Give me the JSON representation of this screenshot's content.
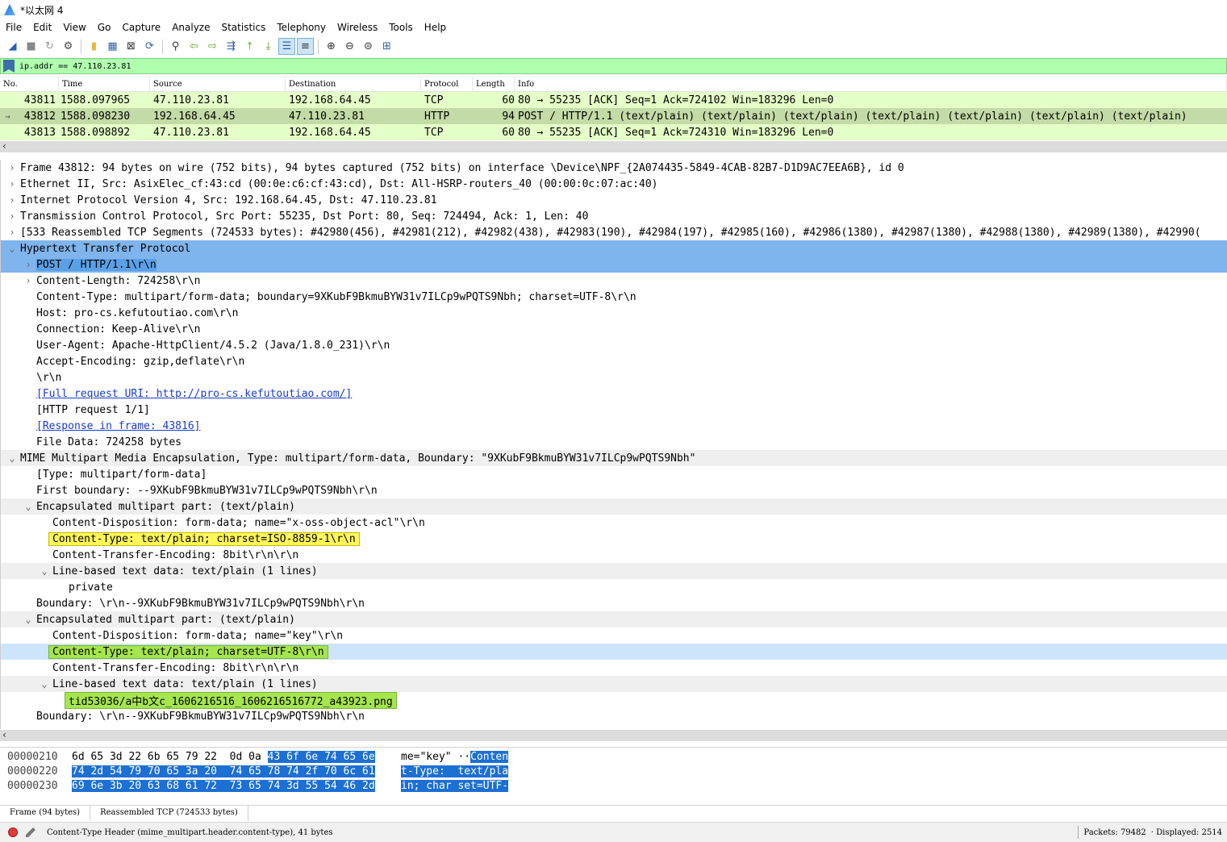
{
  "window": {
    "title": "*以太网 4"
  },
  "menu": [
    "File",
    "Edit",
    "View",
    "Go",
    "Capture",
    "Analyze",
    "Statistics",
    "Telephony",
    "Wireless",
    "Tools",
    "Help"
  ],
  "filter": {
    "value": "ip.addr == 47.110.23.81"
  },
  "packet_list": {
    "columns": [
      "No.",
      "Time",
      "Source",
      "Destination",
      "Protocol",
      "Length",
      "Info"
    ],
    "rows": [
      {
        "no": "43811",
        "time": "1588.097965",
        "src": "47.110.23.81",
        "dst": "192.168.64.45",
        "proto": "TCP",
        "len": "60",
        "info": "80 → 55235 [ACK] Seq=1 Ack=724102 Win=183296 Len=0"
      },
      {
        "no": "43812",
        "time": "1588.098230",
        "src": "192.168.64.45",
        "dst": "47.110.23.81",
        "proto": "HTTP",
        "len": "94",
        "info": "POST / HTTP/1.1  (text/plain) (text/plain) (text/plain) (text/plain) (text/plain) (text/plain) (text/plain)"
      },
      {
        "no": "43813",
        "time": "1588.098892",
        "src": "47.110.23.81",
        "dst": "192.168.64.45",
        "proto": "TCP",
        "len": "60",
        "info": "80 → 55235 [ACK] Seq=1 Ack=724310 Win=183296 Len=0"
      }
    ]
  },
  "tree": [
    {
      "level": 0,
      "arrow": "›",
      "text": "Frame 43812: 94 bytes on wire (752 bits), 94 bytes captured (752 bits) on interface \\Device\\NPF_{2A074435-5849-4CAB-82B7-D1D9AC7EEA6B}, id 0"
    },
    {
      "level": 0,
      "arrow": "›",
      "text": "Ethernet II, Src: AsixElec_cf:43:cd (00:0e:c6:cf:43:cd), Dst: All-HSRP-routers_40 (00:00:0c:07:ac:40)"
    },
    {
      "level": 0,
      "arrow": "›",
      "text": "Internet Protocol Version 4, Src: 192.168.64.45, Dst: 47.110.23.81"
    },
    {
      "level": 0,
      "arrow": "›",
      "text": "Transmission Control Protocol, Src Port: 55235, Dst Port: 80, Seq: 724494, Ack: 1, Len: 40"
    },
    {
      "level": 0,
      "arrow": "›",
      "text": "[533 Reassembled TCP Segments (724533 bytes): #42980(456), #42981(212), #42982(438), #42983(190), #42984(197), #42985(160), #42986(1380), #42987(1380), #42988(1380), #42989(1380), #42990("
    },
    {
      "level": 0,
      "arrow": "⌄",
      "text": "Hypertext Transfer Protocol"
    },
    {
      "level": 1,
      "arrow": "›",
      "text": "POST / HTTP/1.1\\r\\n"
    },
    {
      "level": 1,
      "arrow": "›",
      "text": "Content-Length: 724258\\r\\n"
    },
    {
      "level": 1,
      "arrow": "",
      "text": "Content-Type: multipart/form-data; boundary=9XKubF9BkmuBYW31v7ILCp9wPQTS9Nbh; charset=UTF-8\\r\\n"
    },
    {
      "level": 1,
      "arrow": "",
      "text": "Host: pro-cs.kefutoutiao.com\\r\\n"
    },
    {
      "level": 1,
      "arrow": "",
      "text": "Connection: Keep-Alive\\r\\n"
    },
    {
      "level": 1,
      "arrow": "",
      "text": "User-Agent: Apache-HttpClient/4.5.2 (Java/1.8.0_231)\\r\\n"
    },
    {
      "level": 1,
      "arrow": "",
      "text": "Accept-Encoding: gzip,deflate\\r\\n"
    },
    {
      "level": 1,
      "arrow": "",
      "text": "\\r\\n"
    },
    {
      "level": 1,
      "arrow": "",
      "text": "[Full request URI: http://pro-cs.kefutoutiao.com/]"
    },
    {
      "level": 1,
      "arrow": "",
      "text": "[HTTP request 1/1]"
    },
    {
      "level": 1,
      "arrow": "",
      "text": "[Response in frame: 43816]"
    },
    {
      "level": 1,
      "arrow": "",
      "text": "File Data: 724258 bytes"
    },
    {
      "level": 0,
      "arrow": "⌄",
      "text": "MIME Multipart Media Encapsulation, Type: multipart/form-data, Boundary: \"9XKubF9BkmuBYW31v7ILCp9wPQTS9Nbh\""
    },
    {
      "level": 1,
      "arrow": "",
      "text": "[Type: multipart/form-data]"
    },
    {
      "level": 1,
      "arrow": "",
      "text": "First boundary: --9XKubF9BkmuBYW31v7ILCp9wPQTS9Nbh\\r\\n"
    },
    {
      "level": 1,
      "arrow": "⌄",
      "text": "Encapsulated multipart part:  (text/plain)"
    },
    {
      "level": 2,
      "arrow": "",
      "text": "Content-Disposition: form-data; name=\"x-oss-object-acl\"\\r\\n"
    },
    {
      "level": 2,
      "arrow": "",
      "text": "Content-Type: text/plain; charset=ISO-8859-1\\r\\n"
    },
    {
      "level": 2,
      "arrow": "",
      "text": "Content-Transfer-Encoding: 8bit\\r\\n\\r\\n"
    },
    {
      "level": 2,
      "arrow": "⌄",
      "text": "Line-based text data: text/plain (1 lines)"
    },
    {
      "level": 3,
      "arrow": "",
      "text": "private"
    },
    {
      "level": 1,
      "arrow": "",
      "text": "Boundary: \\r\\n--9XKubF9BkmuBYW31v7ILCp9wPQTS9Nbh\\r\\n"
    },
    {
      "level": 1,
      "arrow": "⌄",
      "text": "Encapsulated multipart part:  (text/plain)"
    },
    {
      "level": 2,
      "arrow": "",
      "text": "Content-Disposition: form-data; name=\"key\"\\r\\n"
    },
    {
      "level": 2,
      "arrow": "",
      "text": "Content-Type: text/plain; charset=UTF-8\\r\\n"
    },
    {
      "level": 2,
      "arrow": "",
      "text": "Content-Transfer-Encoding: 8bit\\r\\n\\r\\n"
    },
    {
      "level": 2,
      "arrow": "⌄",
      "text": "Line-based text data: text/plain (1 lines)"
    },
    {
      "level": 3,
      "arrow": "",
      "text": "tid53036/a中b文c_1606216516_1606216516772_a43923.png"
    },
    {
      "level": 1,
      "arrow": "",
      "text": "Boundary: \\r\\n--9XKubF9BkmuBYW31v7ILCp9wPQTS9Nbh\\r\\n"
    }
  ],
  "hex": [
    {
      "offset": "00000210",
      "plain": "6d 65 3d 22 6b 65 79 22  0d 0a ",
      "sel": "43 6f 6e 74 65 6e",
      "ascii_plain": "me=\"key\" ··",
      "ascii_sel": "Conten"
    },
    {
      "offset": "00000220",
      "plain": "",
      "sel": "74 2d 54 79 70 65 3a 20  74 65 78 74 2f 70 6c 61",
      "ascii_plain": "",
      "ascii_sel": "t-Type:  text/pla"
    },
    {
      "offset": "00000230",
      "plain": "",
      "sel": "69 6e 3b 20 63 68 61 72  73 65 74 3d 55 54 46 2d",
      "ascii_plain": "",
      "ascii_sel": "in; char set=UTF-"
    }
  ],
  "byte_tabs": [
    "Frame (94 bytes)",
    "Reassembled TCP (724533 bytes)"
  ],
  "status": {
    "field": "Content-Type Header (mime_multipart.header.content-type), 41 bytes",
    "packets": "Packets: 79482",
    "displayed": "· Displayed: 2514"
  },
  "colors": {
    "tcp_row": "#e4ffc7",
    "http_row": "#c3dba6",
    "selection": "#7fb4ec",
    "filter_bg": "#afffaf",
    "hex_selection": "#1c6fd3"
  }
}
